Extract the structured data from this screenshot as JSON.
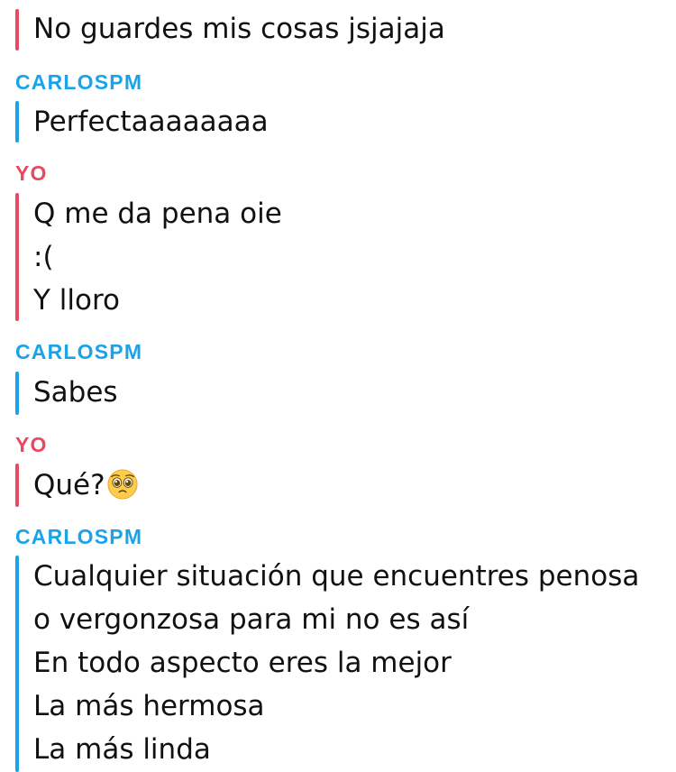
{
  "chat": {
    "messages": [
      {
        "sender": "",
        "lines": [
          "No guardes mis cosas jsjajaja"
        ]
      },
      {
        "sender": "CARLOSPM",
        "lines": [
          "Perfectaaaaaaaa"
        ]
      },
      {
        "sender": "YO",
        "lines": [
          "Q me da pena oie",
          ":(",
          "Y lloro"
        ]
      },
      {
        "sender": "CARLOSPM",
        "lines": [
          "Sabes"
        ]
      },
      {
        "sender": "YO",
        "lines": [
          "Qué?"
        ],
        "emoji": "pleading-face-emoji"
      },
      {
        "sender": "CARLOSPM",
        "lines": [
          "Cualquier situación que encuentres penosa",
          "o vergonzosa para mi no es así",
          "En todo aspecto  eres la mejor",
          "La más hermosa",
          "La más linda"
        ]
      }
    ]
  },
  "colors": {
    "carlos": "#1aa3e8",
    "yo": "#e84860",
    "text": "#111111",
    "background": "#ffffff"
  }
}
